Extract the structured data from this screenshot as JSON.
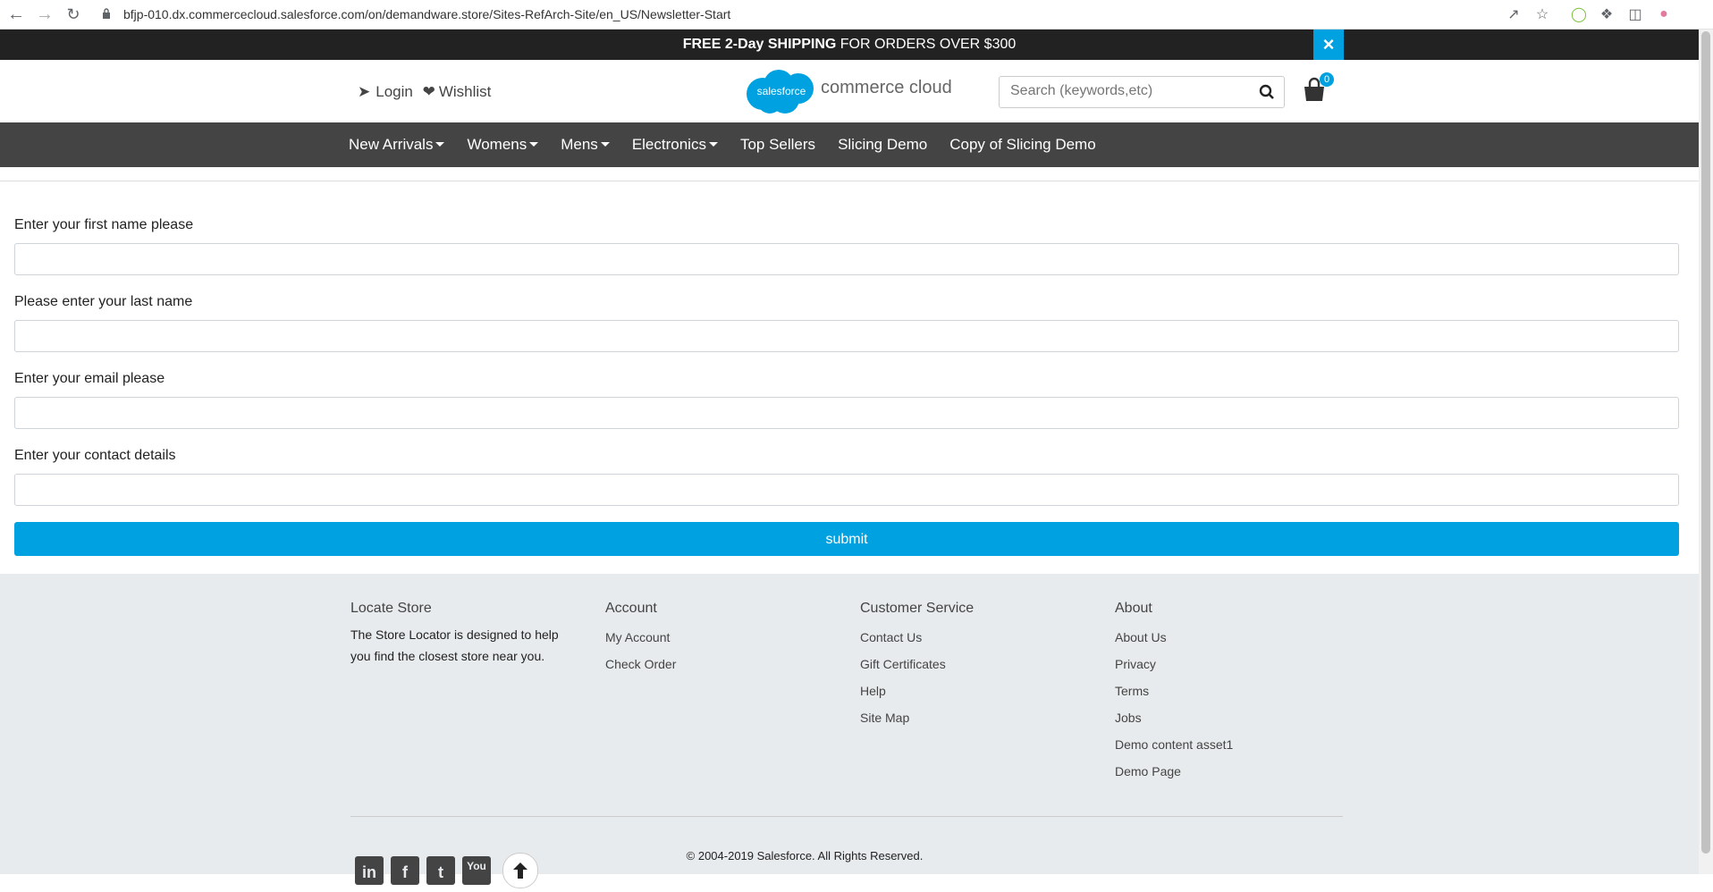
{
  "browser": {
    "url": "bfjp-010.dx.commercecloud.salesforce.com/on/demandware.store/Sites-RefArch-Site/en_US/Newsletter-Start"
  },
  "promo": {
    "bold": "FREE 2-Day SHIPPING",
    "rest": " FOR ORDERS OVER $300",
    "close": "×"
  },
  "header": {
    "login": "Login",
    "wishlist": "Wishlist",
    "logo_cloud_text": "salesforce",
    "logo_text": "commerce cloud",
    "search_placeholder": "Search (keywords,etc)",
    "cart_count": "0"
  },
  "nav": {
    "items": [
      {
        "label": "New Arrivals",
        "dropdown": true
      },
      {
        "label": "Womens",
        "dropdown": true
      },
      {
        "label": "Mens",
        "dropdown": true
      },
      {
        "label": "Electronics",
        "dropdown": true
      },
      {
        "label": "Top Sellers",
        "dropdown": false
      },
      {
        "label": "Slicing Demo",
        "dropdown": false
      },
      {
        "label": "Copy of Slicing Demo",
        "dropdown": false
      }
    ]
  },
  "form": {
    "first_name_label": "Enter your first name please",
    "last_name_label": "Please enter your last name",
    "email_label": "Enter your email please",
    "contact_label": "Enter your contact details",
    "submit_label": "submit"
  },
  "footer": {
    "locate": {
      "title": "Locate Store",
      "text": "The Store Locator is designed to help you find the closest store near you."
    },
    "account": {
      "title": "Account",
      "items": [
        "My Account",
        "Check Order"
      ]
    },
    "service": {
      "title": "Customer Service",
      "items": [
        "Contact Us",
        "Gift Certificates",
        "Help",
        "Site Map"
      ]
    },
    "about": {
      "title": "About",
      "items": [
        "About Us",
        "Privacy",
        "Terms",
        "Jobs",
        "Demo content asset1",
        "Demo Page"
      ]
    },
    "copyright": "© 2004-2019 Salesforce. All Rights Reserved.",
    "social": [
      "in",
      "f",
      "t",
      "You"
    ]
  },
  "colors": {
    "accent": "#00a1e0",
    "nav_bg": "#444444",
    "promo_bg": "#222222",
    "footer_bg": "#e8ebed"
  }
}
